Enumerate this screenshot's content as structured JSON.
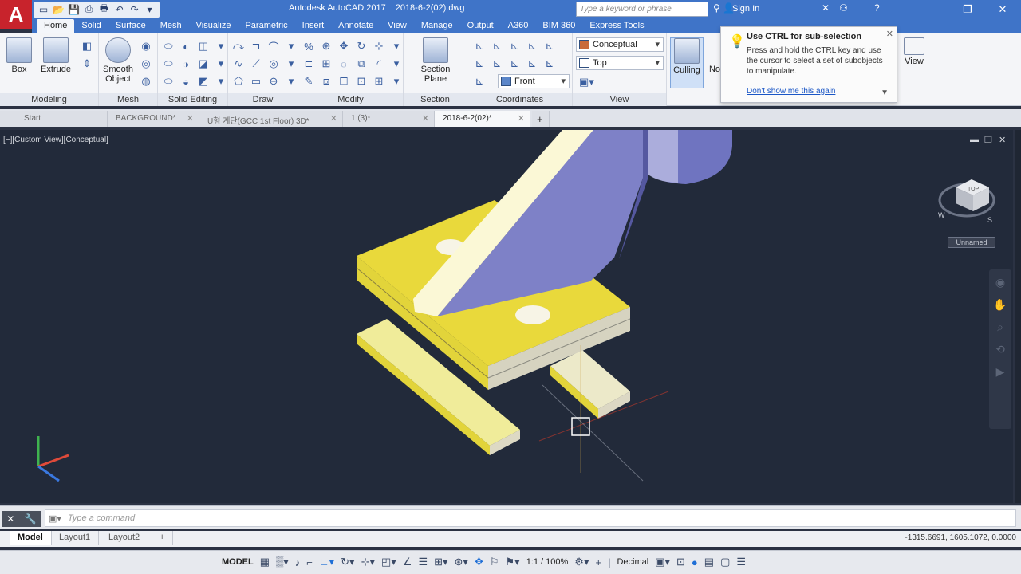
{
  "app": {
    "logo": "A",
    "title": "Autodesk AutoCAD 2017",
    "document": "2018-6-2(02).dwg",
    "search_placeholder": "Type a keyword or phrase",
    "sign_in": "Sign In"
  },
  "ribbon_tabs": [
    "Home",
    "Solid",
    "Surface",
    "Mesh",
    "Visualize",
    "Parametric",
    "Insert",
    "Annotate",
    "View",
    "Manage",
    "Output",
    "A360",
    "BIM 360",
    "Express Tools"
  ],
  "ribbon": {
    "modeling": {
      "title": "Modeling",
      "box": "Box",
      "extrude": "Extrude"
    },
    "mesh": {
      "title": "Mesh",
      "smooth_object_1": "Smooth",
      "smooth_object_2": "Object"
    },
    "solid_editing": {
      "title": "Solid Editing"
    },
    "draw": {
      "title": "Draw"
    },
    "modify": {
      "title": "Modify"
    },
    "section": {
      "title": "Section",
      "section_plane_1": "Section",
      "section_plane_2": "Plane"
    },
    "coordinates": {
      "title": "Coordinates"
    },
    "view": {
      "title": "View",
      "visual_style": "Conceptual",
      "view_top": "Top",
      "view_front": "Front"
    },
    "culling": "Culling",
    "view_btn": "View",
    "no_filter": "No"
  },
  "tooltip": {
    "title": "Use CTRL for sub-selection",
    "body": "Press and hold the CTRL key and use the cursor to select a set of subobjects to manipulate.",
    "link": "Don't show me this again"
  },
  "file_tabs": [
    {
      "label": "Start"
    },
    {
      "label": "BACKGROUND*"
    },
    {
      "label": "U형 계단(GCC 1st Floor) 3D*"
    },
    {
      "label": "1 (3)*"
    },
    {
      "label": "2018-6-2(02)*"
    }
  ],
  "viewport": {
    "label": "[−][Custom View][Conceptual]",
    "viewcube_label": "Unnamed",
    "viewcube_face": "TOP",
    "compass_w": "W",
    "compass_s": "S"
  },
  "command": {
    "placeholder": "Type a command"
  },
  "layout_tabs": [
    "Model",
    "Layout1",
    "Layout2"
  ],
  "coordinates": "-1315.6691, 1605.1072, 0.0000",
  "status": {
    "model": "MODEL",
    "scale": "1:1 / 100%",
    "units": "Decimal"
  },
  "colors": {
    "titlebar": "#3f74c8",
    "viewport_bg": "#222a3a",
    "yellow_face": "#e8d93d",
    "beam_purple": "#7d80c6",
    "logo_red": "#c8232c"
  }
}
